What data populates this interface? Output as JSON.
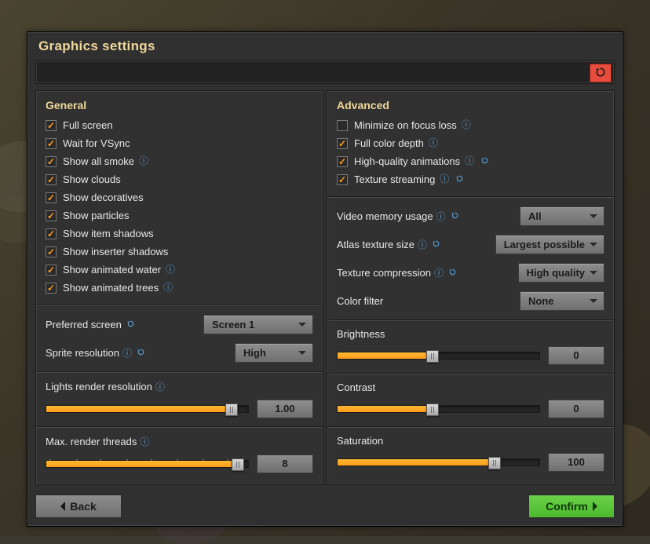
{
  "window": {
    "title": "Graphics settings",
    "reset_icon": "reset-icon"
  },
  "general": {
    "heading": "General",
    "checks": [
      {
        "label": "Full screen",
        "checked": true,
        "info": false
      },
      {
        "label": "Wait for VSync",
        "checked": true,
        "info": false
      },
      {
        "label": "Show all smoke",
        "checked": true,
        "info": true
      },
      {
        "label": "Show clouds",
        "checked": true,
        "info": false
      },
      {
        "label": "Show decoratives",
        "checked": true,
        "info": false
      },
      {
        "label": "Show particles",
        "checked": true,
        "info": false
      },
      {
        "label": "Show item shadows",
        "checked": true,
        "info": false
      },
      {
        "label": "Show inserter shadows",
        "checked": true,
        "info": false
      },
      {
        "label": "Show animated water",
        "checked": true,
        "info": true
      },
      {
        "label": "Show animated trees",
        "checked": true,
        "info": true
      }
    ],
    "preferred_screen": {
      "label": "Preferred screen",
      "value": "Screen 1",
      "info": false,
      "refresh": true
    },
    "sprite_resolution": {
      "label": "Sprite resolution",
      "value": "High",
      "info": true,
      "refresh": true
    },
    "lights_resolution": {
      "label": "Lights render resolution",
      "info": true,
      "position_pct": 92,
      "value": "1.00",
      "ticks": []
    },
    "render_threads": {
      "label": "Max. render threads",
      "info": true,
      "position_pct": 95,
      "value": "8",
      "ticks": [
        2,
        15,
        27,
        40,
        52,
        65,
        78,
        90
      ]
    }
  },
  "advanced": {
    "heading": "Advanced",
    "checks": [
      {
        "label": "Minimize on focus loss",
        "checked": false,
        "info": true,
        "refresh": false
      },
      {
        "label": "Full color depth",
        "checked": true,
        "info": true,
        "refresh": false
      },
      {
        "label": "High-quality animations",
        "checked": true,
        "info": true,
        "refresh": true
      },
      {
        "label": "Texture streaming",
        "checked": true,
        "info": true,
        "refresh": true
      }
    ],
    "video_memory": {
      "label": "Video memory usage",
      "value": "All",
      "info": true,
      "refresh": true
    },
    "atlas_size": {
      "label": "Atlas texture size",
      "value": "Largest possible",
      "info": true,
      "refresh": true
    },
    "tex_compression": {
      "label": "Texture compression",
      "value": "High quality",
      "info": true,
      "refresh": true
    },
    "color_filter": {
      "label": "Color filter",
      "value": "None",
      "info": false,
      "refresh": false
    },
    "brightness": {
      "label": "Brightness",
      "position_pct": 47,
      "value": "0"
    },
    "contrast": {
      "label": "Contrast",
      "position_pct": 47,
      "value": "0"
    },
    "saturation": {
      "label": "Saturation",
      "position_pct": 78,
      "value": "100"
    }
  },
  "footer": {
    "back": "Back",
    "confirm": "Confirm"
  }
}
